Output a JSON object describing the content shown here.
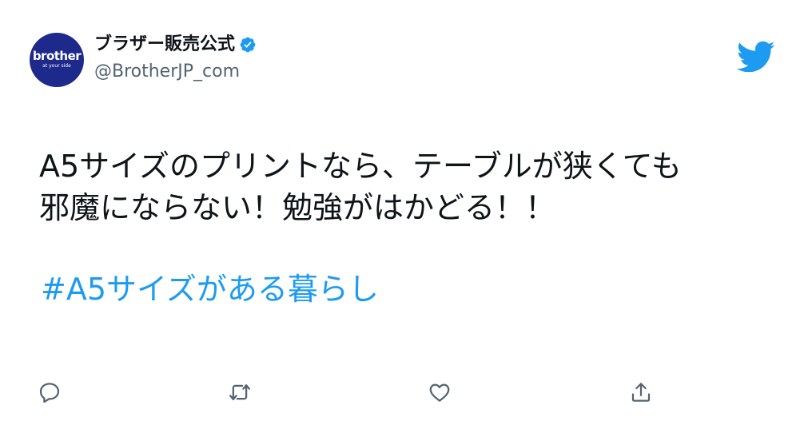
{
  "author": {
    "display_name": "ブラザー販売公式",
    "handle": "@BrotherJP_com",
    "avatar_logo": "brother",
    "avatar_tagline": "at your side",
    "verified": true
  },
  "tweet": {
    "lines": [
      "A5サイズのプリントなら、テーブルが狭くても",
      "邪魔にならない！勉強がはかどる！！"
    ],
    "hashtag": "#A5サイズがある暮らし"
  },
  "actions": [
    {
      "icon": "reply-icon"
    },
    {
      "icon": "retweet-icon"
    },
    {
      "icon": "like-icon"
    },
    {
      "icon": "share-icon"
    }
  ],
  "colors": {
    "accent": "#1d9bf0",
    "text": "#0f1419",
    "secondary": "#536471",
    "avatar_bg": "#1d2a8c"
  }
}
